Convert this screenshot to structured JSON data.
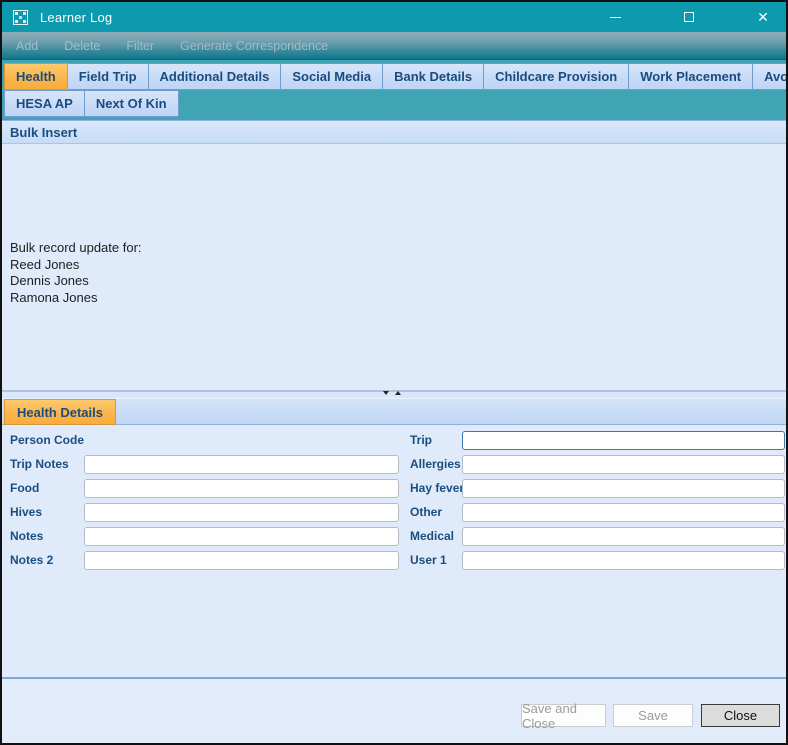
{
  "window": {
    "title": "Learner Log",
    "controls": [
      "minimize",
      "maximize",
      "close"
    ],
    "close_glyph": "✕"
  },
  "toolbar": {
    "items": [
      "Add",
      "Delete",
      "Filter",
      "Generate Correspondence"
    ]
  },
  "tabs": {
    "row1": [
      "Health",
      "Field Trip",
      "Additional Details",
      "Social Media",
      "Bank Details",
      "Childcare Provision",
      "Work Placement",
      "Avocation"
    ],
    "row2": [
      "HESA AP",
      "Next Of Kin"
    ],
    "active": "Health"
  },
  "bulk_insert": {
    "title": "Bulk Insert",
    "lines": [
      "Bulk record update for:",
      "Reed Jones",
      "Dennis Jones",
      "Ramona Jones"
    ]
  },
  "details": {
    "tab": "Health Details",
    "rows": [
      {
        "left_label": "Person Code",
        "right_label": "Trip",
        "right_value": ""
      },
      {
        "left_label": "Trip Notes",
        "left_value": "",
        "right_label": "Allergies",
        "right_value": ""
      },
      {
        "left_label": "Food",
        "left_value": "",
        "right_label": "Hay fever",
        "right_value": ""
      },
      {
        "left_label": "Hives",
        "left_value": "",
        "right_label": "Other",
        "right_value": ""
      },
      {
        "left_label": "Notes",
        "left_value": "",
        "right_label": "Medical",
        "right_value": ""
      },
      {
        "left_label": "Notes 2",
        "left_value": "",
        "right_label": "User 1",
        "right_value": ""
      }
    ],
    "focused_field": "Trip"
  },
  "footer": {
    "buttons": [
      "Save and Close",
      "Save",
      "Close"
    ]
  },
  "colors": {
    "titlebar": "#0D9AAE",
    "active_tab": "#FBB54B",
    "label_blue": "#1B4E7F",
    "panel_bg": "#DFEAFB"
  }
}
